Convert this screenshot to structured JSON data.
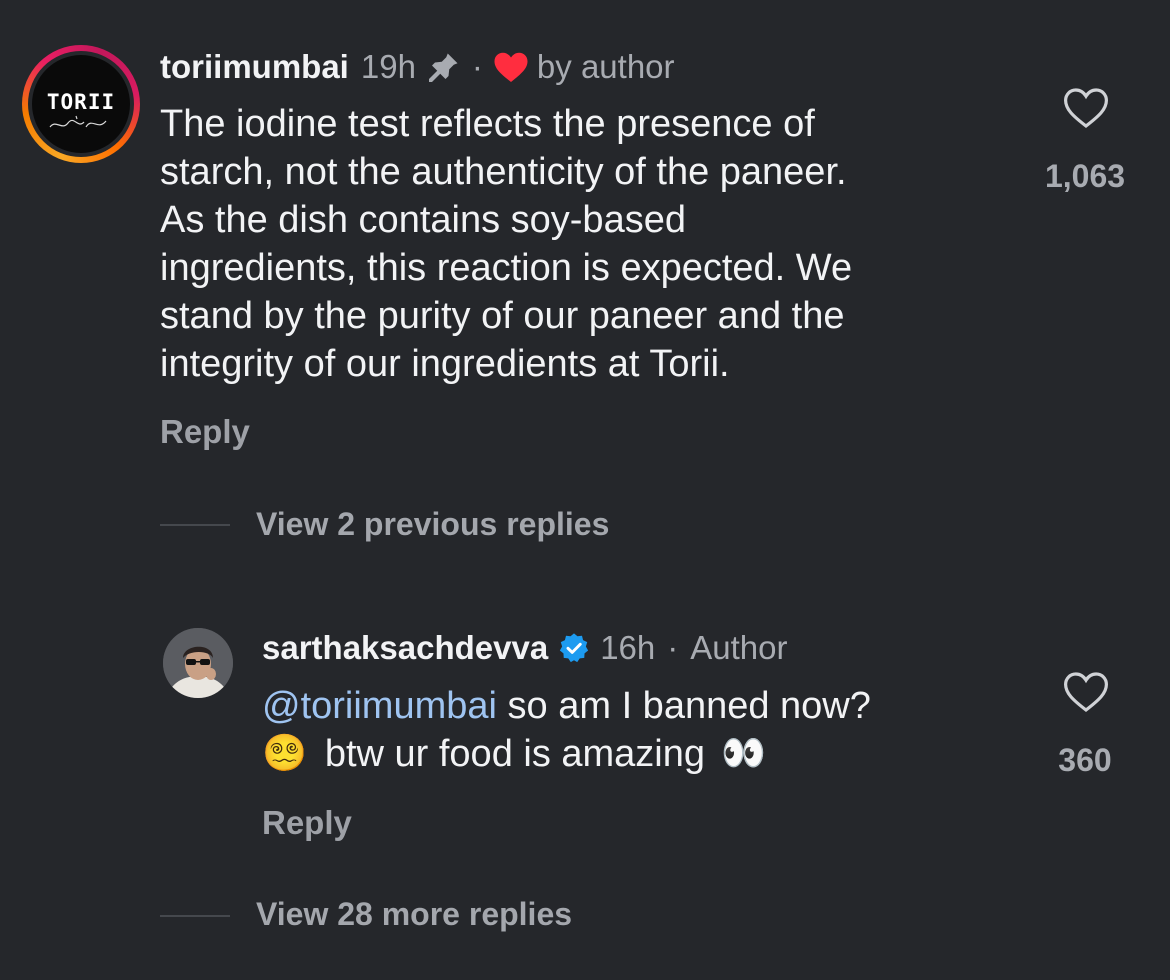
{
  "comments": [
    {
      "username": "toriimumbai",
      "avatar_logo": "TORII",
      "time": "19h",
      "pin_icon": "pin-icon",
      "separator": "·",
      "liked_badge": "by author",
      "text_lines": [
        "The iodine test reflects the presence of",
        "starch, not the authenticity of the paneer.",
        "As the dish contains soy-based",
        "ingredients, this reaction is expected. We",
        "stand by the purity of our paneer and the",
        "integrity of our ingredients at Torii."
      ],
      "like_count": "1,063",
      "reply_label": "Reply",
      "view_replies": "View 2 previous replies"
    },
    {
      "username": "sarthaksachdevva",
      "verified": true,
      "time": "16h",
      "separator": "·",
      "author_label": "Author",
      "mention": "@toriimumbai",
      "text_part1": " so am I banned now?",
      "emoji_dizzy": "😵‍💫",
      "text_part2": "btw ur food is amazing",
      "emoji_eyes": "👀",
      "like_count": "360",
      "reply_label": "Reply",
      "view_replies": "View 28 more replies"
    }
  ],
  "colors": {
    "background": "#25272b",
    "heart_red": "#ff2d3f",
    "verified_blue": "#1d9bf0",
    "mention_blue": "#9fc4f1",
    "muted_text": "#a8abb1"
  }
}
